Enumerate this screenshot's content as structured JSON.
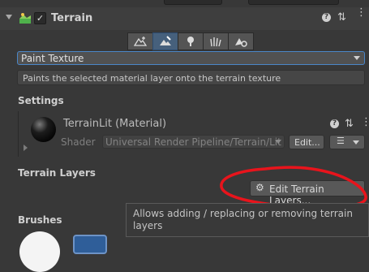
{
  "component": {
    "title": "Terrain",
    "enabled": true
  },
  "tools": [
    {
      "name": "raise-lower-icon",
      "selected": false
    },
    {
      "name": "paint-brush-icon",
      "selected": true
    },
    {
      "name": "tree-icon",
      "selected": false
    },
    {
      "name": "grass-icon",
      "selected": false
    },
    {
      "name": "settings-mountain-icon",
      "selected": false
    }
  ],
  "mode": {
    "selected": "Paint Texture",
    "description": "Paints the selected material layer onto the terrain texture"
  },
  "settings": {
    "label": "Settings",
    "material_name": "TerrainLit (Material)",
    "shader_label": "Shader",
    "shader_value": "Universal Render Pipeline/Terrain/Lit",
    "edit_label": "Edit..."
  },
  "layers": {
    "label": "Terrain Layers",
    "edit_button": "Edit Terrain Layers...",
    "tooltip": "Allows adding / replacing or removing terrain layers"
  },
  "brushes": {
    "label": "Brushes"
  },
  "colors": {
    "accent": "#4a86c8",
    "annotation": "#e8141c",
    "panel": "#383838"
  }
}
